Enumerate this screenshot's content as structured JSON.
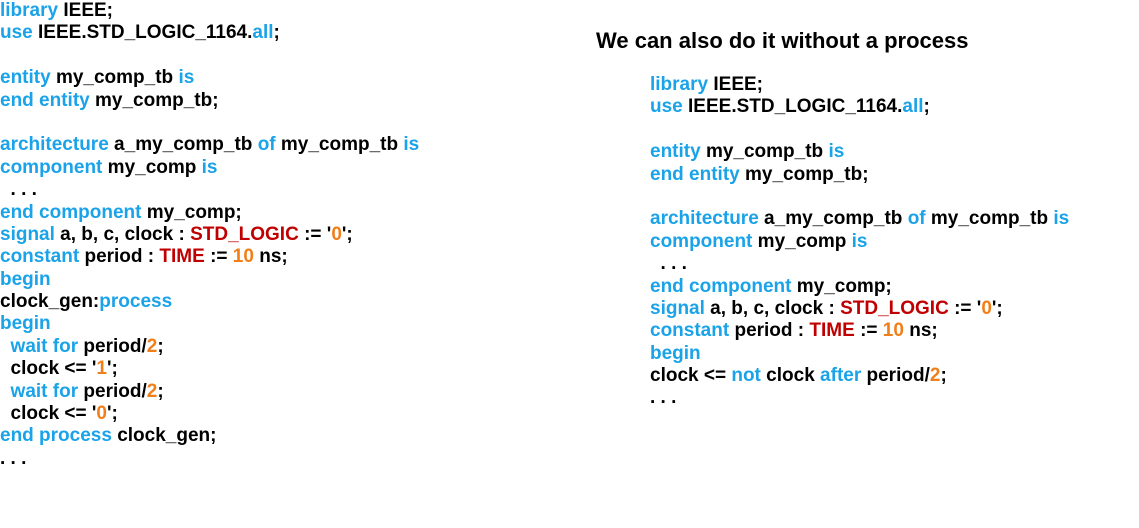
{
  "colors": {
    "keyword": "#1aa3e8",
    "text": "#000000",
    "type": "#c00000",
    "number": "#f07f1a"
  },
  "heading": "We can also do it without a process",
  "left_code": [
    [
      [
        "kw",
        "library"
      ],
      [
        "tx",
        " IEEE;"
      ]
    ],
    [
      [
        "kw",
        "use"
      ],
      [
        "tx",
        " IEEE.STD_LOGIC_1164."
      ],
      [
        "kw",
        "all"
      ],
      [
        "tx",
        ";"
      ]
    ],
    [],
    [
      [
        "kw",
        "entity"
      ],
      [
        "tx",
        " my_comp_tb "
      ],
      [
        "kw",
        "is"
      ]
    ],
    [
      [
        "kw",
        "end entity"
      ],
      [
        "tx",
        " my_comp_tb;"
      ]
    ],
    [],
    [
      [
        "kw",
        "architecture"
      ],
      [
        "tx",
        " a_my_comp_tb "
      ],
      [
        "kw",
        "of"
      ],
      [
        "tx",
        " my_comp_tb "
      ],
      [
        "kw",
        "is"
      ]
    ],
    [
      [
        "kw",
        "component"
      ],
      [
        "tx",
        " my_comp "
      ],
      [
        "kw",
        "is"
      ]
    ],
    [
      [
        "tx",
        "  . . ."
      ]
    ],
    [
      [
        "kw",
        "end component"
      ],
      [
        "tx",
        " my_comp;"
      ]
    ],
    [
      [
        "kw",
        "signal"
      ],
      [
        "tx",
        " a, b, c, clock : "
      ],
      [
        "ty",
        "STD_LOGIC"
      ],
      [
        "tx",
        " := '"
      ],
      [
        "nm",
        "0"
      ],
      [
        "tx",
        "';"
      ]
    ],
    [
      [
        "kw",
        "constant"
      ],
      [
        "tx",
        " period : "
      ],
      [
        "ty",
        "TIME"
      ],
      [
        "tx",
        " := "
      ],
      [
        "nm",
        "10"
      ],
      [
        "tx",
        " ns;"
      ]
    ],
    [
      [
        "kw",
        "begin"
      ]
    ],
    [
      [
        "tx",
        "clock_gen:"
      ],
      [
        "kw",
        "process"
      ]
    ],
    [
      [
        "kw",
        "begin"
      ]
    ],
    [
      [
        "kw",
        "  wait for"
      ],
      [
        "tx",
        " period/"
      ],
      [
        "nm",
        "2"
      ],
      [
        "tx",
        ";"
      ]
    ],
    [
      [
        "tx",
        "  clock <= '"
      ],
      [
        "nm",
        "1"
      ],
      [
        "tx",
        "';"
      ]
    ],
    [
      [
        "kw",
        "  wait for"
      ],
      [
        "tx",
        " period/"
      ],
      [
        "nm",
        "2"
      ],
      [
        "tx",
        ";"
      ]
    ],
    [
      [
        "tx",
        "  clock <= '"
      ],
      [
        "nm",
        "0"
      ],
      [
        "tx",
        "';"
      ]
    ],
    [
      [
        "kw",
        "end process"
      ],
      [
        "tx",
        " clock_gen;"
      ]
    ],
    [
      [
        "tx",
        ". . ."
      ]
    ]
  ],
  "right_code": [
    [
      [
        "kw",
        "library"
      ],
      [
        "tx",
        " IEEE;"
      ]
    ],
    [
      [
        "kw",
        "use"
      ],
      [
        "tx",
        " IEEE.STD_LOGIC_1164."
      ],
      [
        "kw",
        "all"
      ],
      [
        "tx",
        ";"
      ]
    ],
    [],
    [
      [
        "kw",
        "entity"
      ],
      [
        "tx",
        " my_comp_tb "
      ],
      [
        "kw",
        "is"
      ]
    ],
    [
      [
        "kw",
        "end entity"
      ],
      [
        "tx",
        " my_comp_tb;"
      ]
    ],
    [],
    [
      [
        "kw",
        "architecture"
      ],
      [
        "tx",
        " a_my_comp_tb "
      ],
      [
        "kw",
        "of"
      ],
      [
        "tx",
        " my_comp_tb "
      ],
      [
        "kw",
        "is"
      ]
    ],
    [
      [
        "kw",
        "component"
      ],
      [
        "tx",
        " my_comp "
      ],
      [
        "kw",
        "is"
      ]
    ],
    [
      [
        "tx",
        "  . . ."
      ]
    ],
    [
      [
        "kw",
        "end component"
      ],
      [
        "tx",
        " my_comp;"
      ]
    ],
    [
      [
        "kw",
        "signal"
      ],
      [
        "tx",
        " a, b, c, clock : "
      ],
      [
        "ty",
        "STD_LOGIC"
      ],
      [
        "tx",
        " := '"
      ],
      [
        "nm",
        "0"
      ],
      [
        "tx",
        "';"
      ]
    ],
    [
      [
        "kw",
        "constant"
      ],
      [
        "tx",
        " period : "
      ],
      [
        "ty",
        "TIME"
      ],
      [
        "tx",
        " := "
      ],
      [
        "nm",
        "10"
      ],
      [
        "tx",
        " ns;"
      ]
    ],
    [
      [
        "kw",
        "begin"
      ]
    ],
    [
      [
        "tx",
        "clock <= "
      ],
      [
        "kw",
        "not"
      ],
      [
        "tx",
        " clock "
      ],
      [
        "kw",
        "after"
      ],
      [
        "tx",
        " period/"
      ],
      [
        "nm",
        "2"
      ],
      [
        "tx",
        ";"
      ]
    ],
    [
      [
        "tx",
        ". . ."
      ]
    ]
  ]
}
